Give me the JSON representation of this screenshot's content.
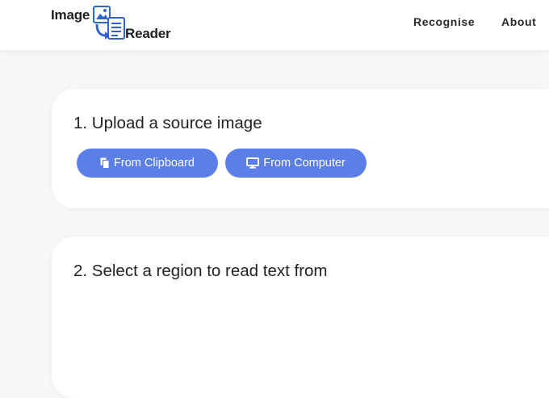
{
  "header": {
    "logo": {
      "word1": "Image",
      "word2": "Reader",
      "icon": "document-scan-icon"
    },
    "nav": [
      {
        "label": "Recognise"
      },
      {
        "label": "About"
      }
    ]
  },
  "steps": [
    {
      "title": "1. Upload a source image",
      "buttons": [
        {
          "label": "From Clipboard",
          "icon": "clipboard-icon"
        },
        {
          "label": "From Computer",
          "icon": "monitor-icon"
        }
      ]
    },
    {
      "title": "2. Select a region to read text from"
    }
  ],
  "colors": {
    "accent": "#5b7ee8",
    "logo_blue": "#2f64c9",
    "background": "#f6f7f9",
    "card": "#ffffff"
  }
}
